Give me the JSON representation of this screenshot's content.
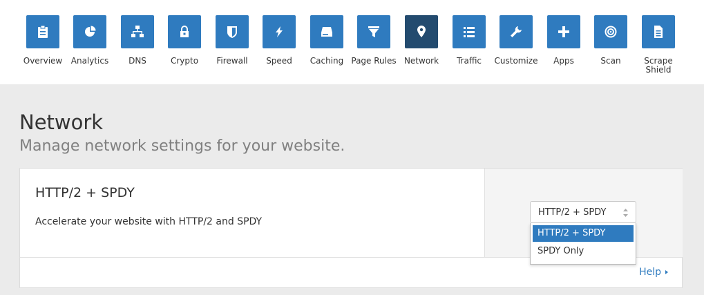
{
  "nav": {
    "items": [
      {
        "label": "Overview",
        "icon": "clipboard-icon"
      },
      {
        "label": "Analytics",
        "icon": "pie-chart-icon"
      },
      {
        "label": "DNS",
        "icon": "network-tree-icon"
      },
      {
        "label": "Crypto",
        "icon": "lock-icon"
      },
      {
        "label": "Firewall",
        "icon": "shield-icon"
      },
      {
        "label": "Speed",
        "icon": "lightning-icon"
      },
      {
        "label": "Caching",
        "icon": "drive-icon"
      },
      {
        "label": "Page Rules",
        "icon": "filter-icon"
      },
      {
        "label": "Network",
        "icon": "location-pin-icon",
        "active": true
      },
      {
        "label": "Traffic",
        "icon": "list-icon"
      },
      {
        "label": "Customize",
        "icon": "wrench-icon"
      },
      {
        "label": "Apps",
        "icon": "plus-icon"
      },
      {
        "label": "Scan",
        "icon": "target-icon"
      },
      {
        "label": "Scrape Shield",
        "icon": "document-icon"
      }
    ]
  },
  "page": {
    "title": "Network",
    "subtitle": "Manage network settings for your website."
  },
  "setting": {
    "title": "HTTP/2 + SPDY",
    "description": "Accelerate your website with HTTP/2 and SPDY",
    "select": {
      "value": "HTTP/2 + SPDY",
      "options": [
        "HTTP/2 + SPDY",
        "SPDY Only"
      ]
    },
    "help_label": "Help"
  },
  "colors": {
    "accent": "#2f7bbf",
    "active_tab": "#234b6f",
    "background": "#ebebeb"
  }
}
